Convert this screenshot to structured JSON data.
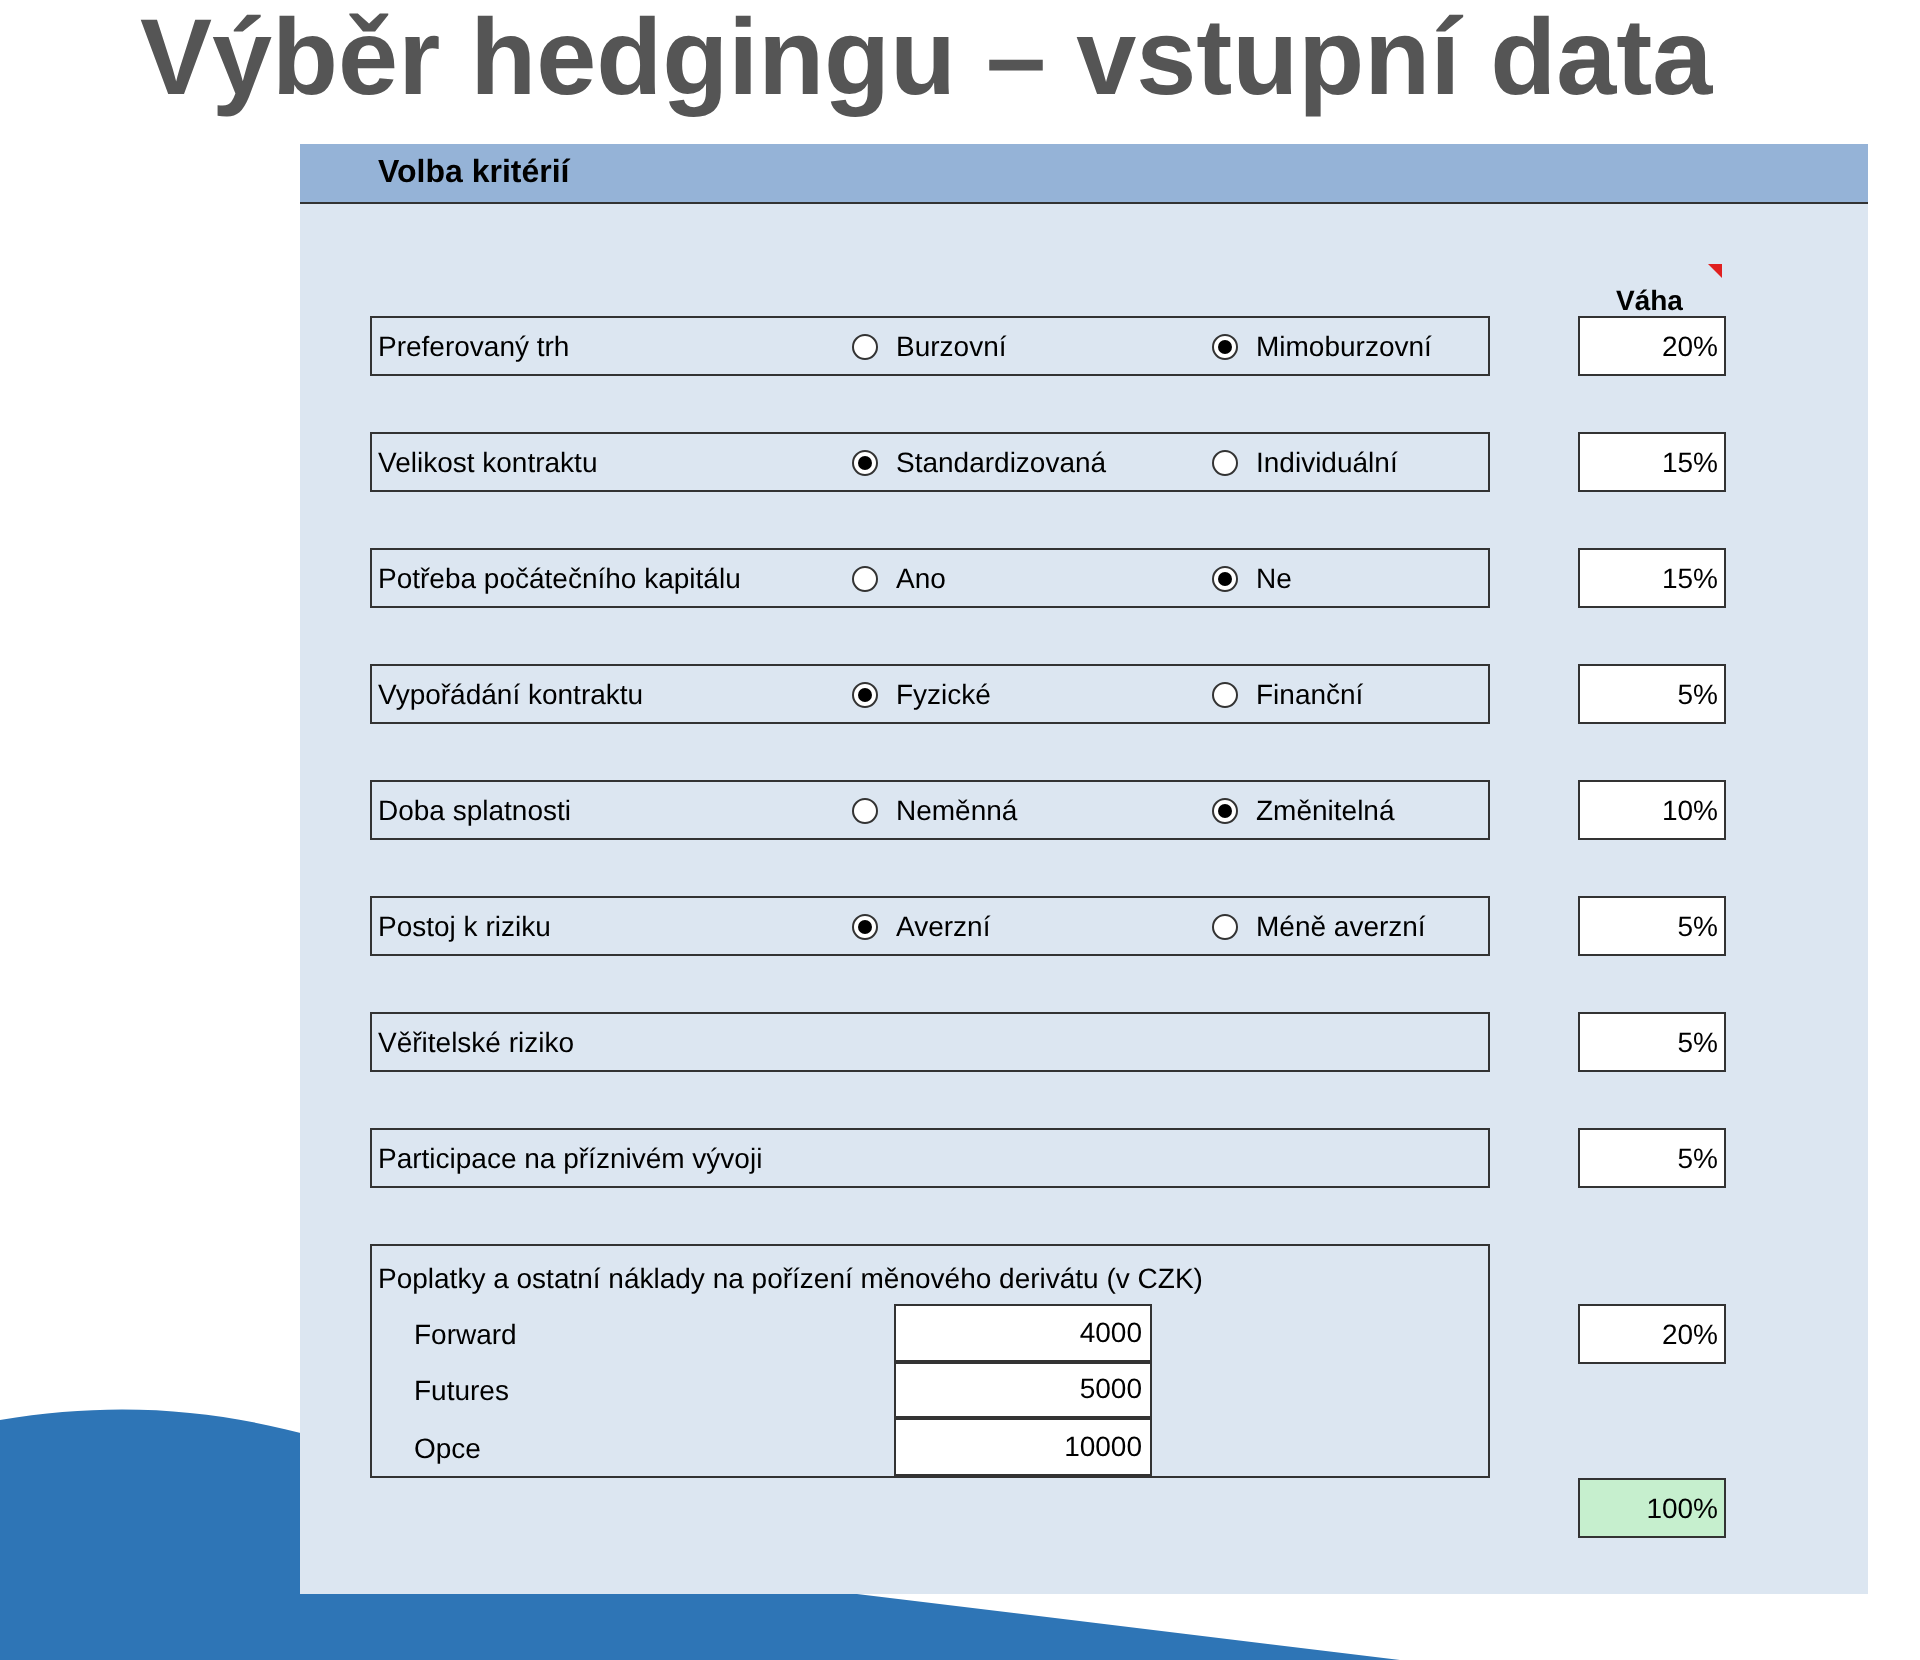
{
  "title": "Výběr hedgingu – vstupní data",
  "panel": {
    "header": "Volba kritérií",
    "weight_heading": "Váha",
    "criteria": [
      {
        "kind": "radio",
        "label": "Preferovaný trh",
        "options": [
          {
            "label": "Burzovní",
            "selected": false
          },
          {
            "label": "Mimoburzovní",
            "selected": true
          }
        ],
        "weight": "20%"
      },
      {
        "kind": "radio",
        "label": "Velikost kontraktu",
        "options": [
          {
            "label": "Standardizovaná",
            "selected": true
          },
          {
            "label": "Individuální",
            "selected": false
          }
        ],
        "weight": "15%"
      },
      {
        "kind": "radio",
        "label": "Potřeba počátečního kapitálu",
        "options": [
          {
            "label": "Ano",
            "selected": false
          },
          {
            "label": "Ne",
            "selected": true
          }
        ],
        "weight": "15%"
      },
      {
        "kind": "radio",
        "label": "Vypořádání kontraktu",
        "options": [
          {
            "label": "Fyzické",
            "selected": true
          },
          {
            "label": "Finanční",
            "selected": false
          }
        ],
        "weight": "5%"
      },
      {
        "kind": "radio",
        "label": "Doba splatnosti",
        "options": [
          {
            "label": "Neměnná",
            "selected": false
          },
          {
            "label": "Změnitelná",
            "selected": true
          }
        ],
        "weight": "10%"
      },
      {
        "kind": "radio",
        "label": "Postoj k riziku",
        "options": [
          {
            "label": "Averzní",
            "selected": true
          },
          {
            "label": "Méně averzní",
            "selected": false
          }
        ],
        "weight": "5%"
      },
      {
        "kind": "plain",
        "label": "Věřitelské riziko",
        "weight": "5%"
      },
      {
        "kind": "plain",
        "label": "Participace na příznivém vývoji",
        "weight": "5%"
      },
      {
        "kind": "costs",
        "label": "Poplatky a ostatní náklady na pořízení měnového derivátu (v CZK)",
        "items": [
          {
            "label": "Forward",
            "value": "4000"
          },
          {
            "label": "Futures",
            "value": "5000"
          },
          {
            "label": "Opce",
            "value": "10000"
          }
        ],
        "weight": "20%"
      }
    ],
    "total": "100%"
  }
}
